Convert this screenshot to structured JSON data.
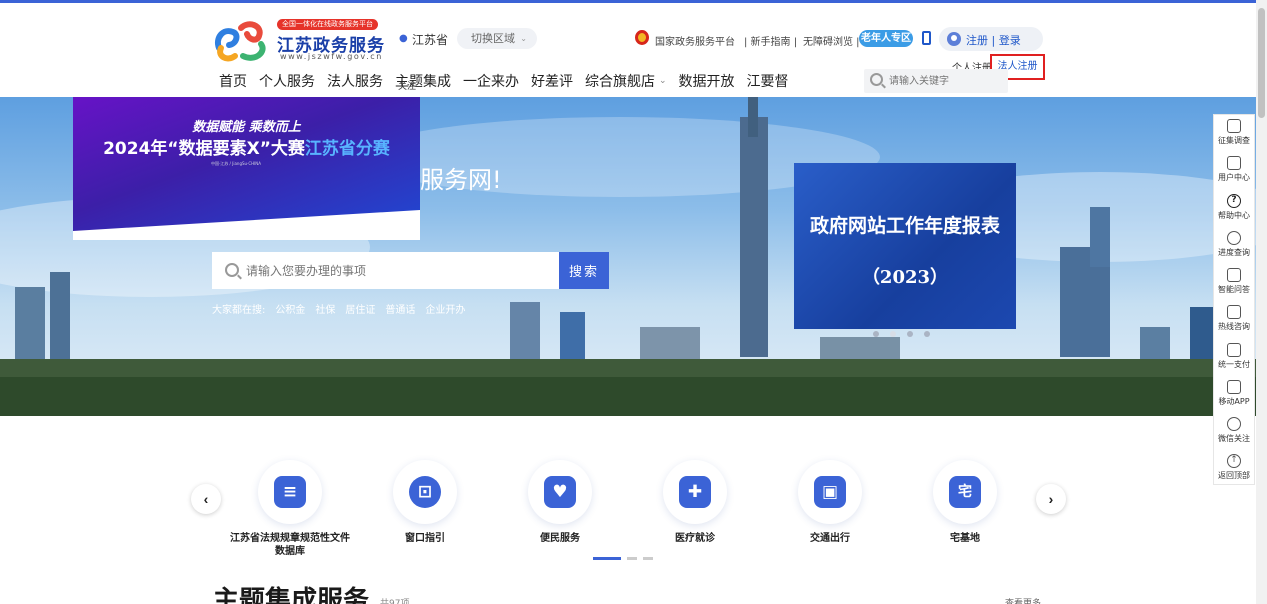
{
  "header": {
    "logo_badge": "全国一体化在线政务服务平台",
    "logo_title": "江苏政务服务",
    "logo_domain": "www.jszwfw.gov.cn",
    "location": "江苏省",
    "switch_region": "切换区域",
    "gov_platform": "国家政务服务平台",
    "guide": "| 新手指南 |",
    "accessible": "无障碍浏览 |",
    "elder_zone": "老年人专区",
    "register": "注册",
    "divider": " | ",
    "login": "登录",
    "personal_register": "个人注册",
    "corporate_register": "法人注册",
    "search_placeholder": "请输入关键字"
  },
  "nav": {
    "items": [
      "首页",
      "个人服务",
      "法人服务",
      "主题集成",
      "一企来办",
      "好差评",
      "综合旗舰店",
      "数据开放",
      "江要督"
    ],
    "sub_label": "关注"
  },
  "banner": {
    "promo_line1": "数据赋能  乘数而上",
    "promo_line2_a": "2024年“数据要素",
    "promo_line2_x": "X",
    "promo_line2_b": "”大赛",
    "promo_line2_c": "江苏省分赛",
    "promo_small": "中国·江苏 / JiangSu·CHINA",
    "welcome": "服务网!",
    "search_placeholder": "请输入您要办理的事项",
    "search_button": "搜索",
    "hot_label": "大家都在搜:",
    "hot_terms": [
      "公积金",
      "社保",
      "居住证",
      "普通话",
      "企业开办"
    ],
    "report_title": "政府网站工作年度报表",
    "report_year": "（2023）"
  },
  "float_bar": {
    "items": [
      "征集调查",
      "用户中心",
      "帮助中心",
      "进度查询",
      "智能问答",
      "热线咨询",
      "统一支付",
      "移动APP",
      "微信关注",
      "返回顶部"
    ]
  },
  "services": {
    "items": [
      {
        "label": "江苏省法规规章规范性文件数据库",
        "icon": "database-icon",
        "glyph": "≡"
      },
      {
        "label": "窗口指引",
        "icon": "window-guide-icon",
        "glyph": "⊡"
      },
      {
        "label": "便民服务",
        "icon": "heart-hand-icon",
        "glyph": "♥"
      },
      {
        "label": "医疗就诊",
        "icon": "medical-folder-icon",
        "glyph": "✚"
      },
      {
        "label": "交通出行",
        "icon": "bus-icon",
        "glyph": "▣"
      },
      {
        "label": "宅基地",
        "icon": "homestead-icon",
        "glyph": "宅"
      }
    ],
    "prev": "‹",
    "next": "›"
  },
  "section": {
    "title": "主题集成服务",
    "count": "共97项",
    "view_more": "查看更多"
  },
  "colors": {
    "primary": "#3b63d6",
    "brand_blue": "#1a3fa8",
    "highlight_red": "#e02020"
  }
}
